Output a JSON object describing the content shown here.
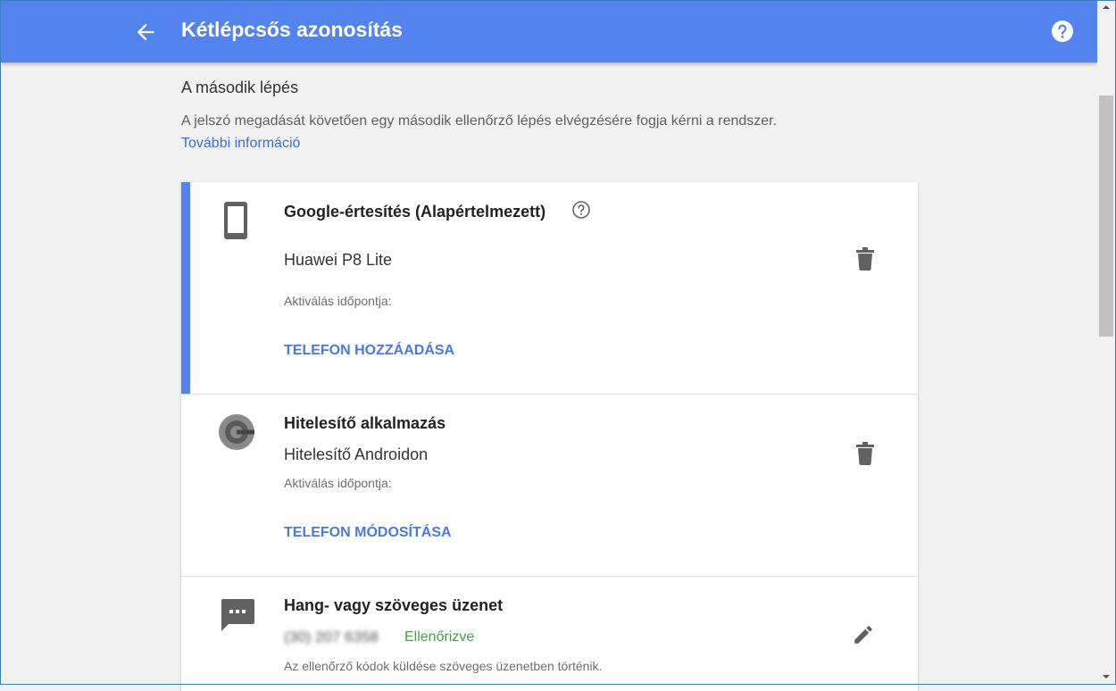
{
  "header": {
    "title": "Kétlépcsős azonosítás"
  },
  "intro": {
    "heading": "A második lépés",
    "description": "A jelszó megadását követően egy második ellenőrző lépés elvégzésére fogja kérni a rendszer.",
    "link": "További információ"
  },
  "methods": [
    {
      "title": "Google-értesítés (Alapértelmezett)",
      "device": "Huawei P8 Lite",
      "activation": "Aktiválás időpontja:",
      "action": "TELEFON HOZZÁADÁSA"
    },
    {
      "title": "Hitelesítő alkalmazás",
      "device": "Hitelesítő Androidon",
      "activation": "Aktiválás időpontja:",
      "action": "TELEFON MÓDOSÍTÁSA"
    },
    {
      "title": "Hang- vagy szöveges üzenet",
      "phone": "(30) 207 6358",
      "status": "Ellenőrizve",
      "note": "Az ellenőrző kódok küldése szöveges üzenetben történik."
    }
  ],
  "colors": {
    "header": "#5383ef",
    "link": "#3b6fd8",
    "verified": "#43a047"
  }
}
